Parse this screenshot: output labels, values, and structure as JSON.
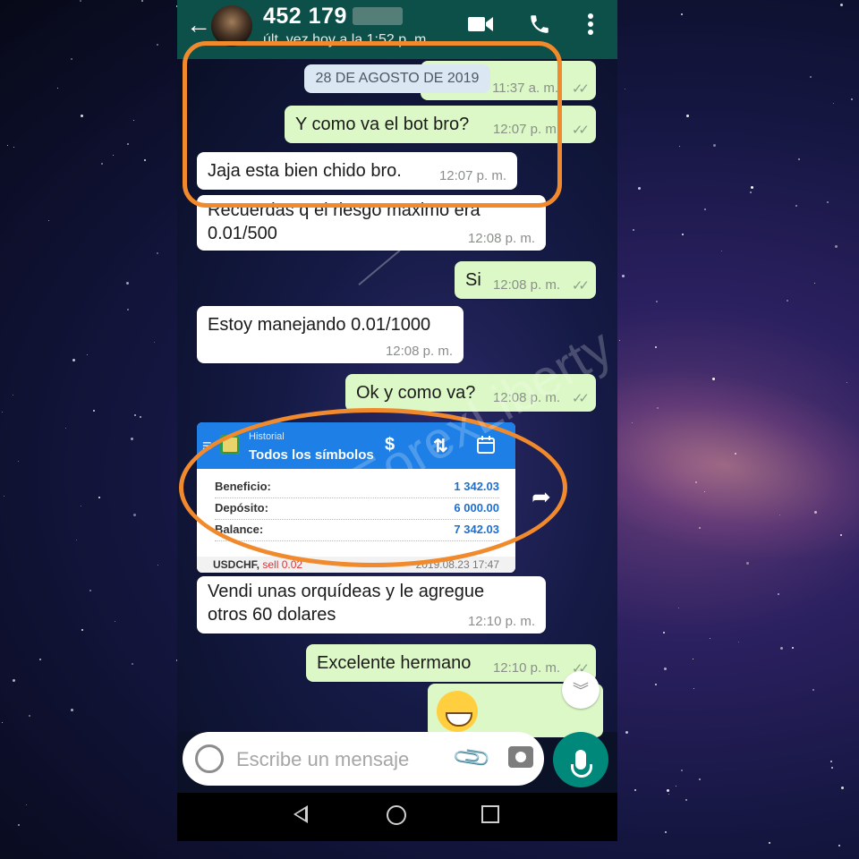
{
  "contact": {
    "name": "452 179",
    "last_seen": "últ. vez hoy a la 1:52 p. m."
  },
  "date_chip": "28 DE AGOSTO DE 2019",
  "messages": [
    {
      "dir": "out",
      "text": "",
      "time": "11:37 a. m."
    },
    {
      "dir": "out",
      "text": "Y como va el bot bro?",
      "time": "12:07 p. m."
    },
    {
      "dir": "in",
      "text": "Jaja esta bien chido bro.",
      "time": "12:07 p. m."
    },
    {
      "dir": "in",
      "text": "Recuerdas q el riesgo maximo era\n0.01/500",
      "time": "12:08 p. m."
    },
    {
      "dir": "out",
      "text": "Si",
      "time": "12:08 p. m."
    },
    {
      "dir": "in",
      "text": "Estoy manejando 0.01/1000",
      "time": "12:08 p. m."
    },
    {
      "dir": "out",
      "text": "Ok y como va?",
      "time": "12:08 p. m."
    },
    {
      "dir": "in",
      "text": "Vendi unas orquídeas y le agregue\notros 60 dolares",
      "time": "12:10 p. m."
    },
    {
      "dir": "out",
      "text": "Excelente hermano",
      "time": "12:10 p. m."
    }
  ],
  "history_card": {
    "subtitle": "Historial",
    "title": "Todos los símbolos",
    "rows": [
      {
        "label": "Beneficio:",
        "value": "1 342.03"
      },
      {
        "label": "Depósito:",
        "value": "6 000.00"
      },
      {
        "label": "Balance:",
        "value": "7 342.03"
      }
    ],
    "footer_symbol": "USDCHF,",
    "footer_action": "sell 0.02",
    "footer_date": "2019.08.23 17:47"
  },
  "composer": {
    "placeholder": "Escribe un mensaje"
  },
  "watermark": "ForexLiberty",
  "icons": {
    "back": "back-arrow-icon",
    "video": "video-call-icon",
    "phone": "phone-call-icon",
    "menu": "more-vert-icon",
    "emoji": "emoji-icon",
    "attach": "paperclip-icon",
    "camera": "camera-icon",
    "mic": "microphone-icon",
    "share": "forward-icon",
    "scroll": "double-chevron-down-icon"
  },
  "colors": {
    "header": "#0d4f49",
    "outgoing": "#dcf8c6",
    "incoming": "#ffffff",
    "mic": "#00897b",
    "annotation": "#f08a2c",
    "card_header": "#1e7fe6"
  }
}
